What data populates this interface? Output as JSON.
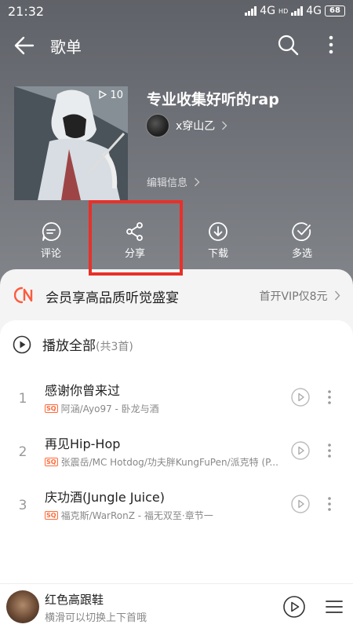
{
  "status_bar": {
    "time": "21:32",
    "net1": "4G",
    "net2": "4G",
    "hd": "HD",
    "battery": "68"
  },
  "header": {
    "title": "歌单"
  },
  "playlist": {
    "play_count": "10",
    "title": "专业收集好听的rap",
    "creator": "x穿山乙",
    "edit_info": "编辑信息"
  },
  "actions": {
    "comment": "评论",
    "share": "分享",
    "download": "下载",
    "multiselect": "多选"
  },
  "vip_banner": {
    "text": "会员享高品质听觉盛宴",
    "promo": "首开VIP仅8元"
  },
  "play_all": {
    "label": "播放全部",
    "count": "(共3首)"
  },
  "songs": [
    {
      "index": "1",
      "name": "感谢你曾来过",
      "quality": "SQ",
      "artist": "阿涵/Ayo97 - 卧龙与酒"
    },
    {
      "index": "2",
      "name": "再见Hip-Hop",
      "quality": "SQ",
      "artist": "张震岳/MC Hotdog/功夫胖KungFuPen/派克特 (P..."
    },
    {
      "index": "3",
      "name": "庆功酒(Jungle Juice)",
      "quality": "SQ",
      "artist": "福克斯/WarRonZ - 福无双至·章节一"
    }
  ],
  "mini_player": {
    "song": "红色高跟鞋",
    "hint": "横滑可以切换上下首哦"
  },
  "colors": {
    "highlight": "#e8302a",
    "vip_accent": "#ff5a3c",
    "sq_badge": "#ff6a3a"
  }
}
